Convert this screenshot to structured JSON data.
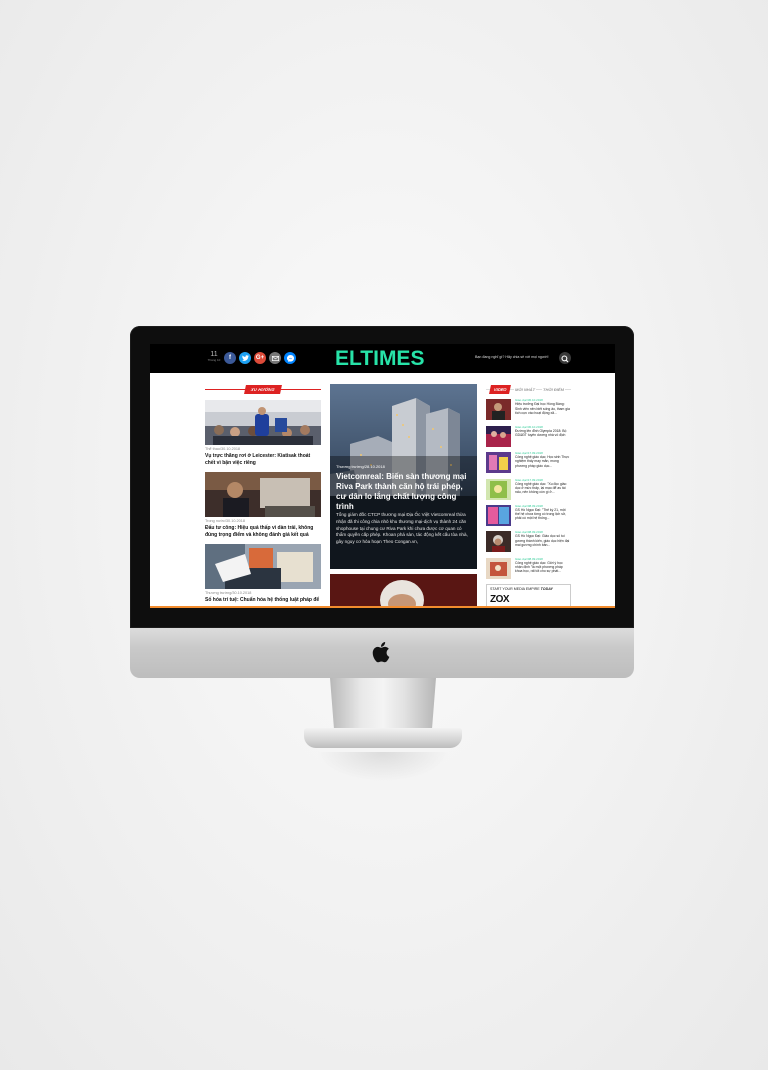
{
  "header": {
    "date_day": "11",
    "date_month": "Tháng 10",
    "logo": "ELTIMES",
    "search_placeholder": "Bạn đang nghĩ gì? Hãy chia sẻ với mọi người!",
    "social_icons": [
      "facebook-icon",
      "twitter-icon",
      "google-plus-icon",
      "mail-icon",
      "messenger-icon"
    ]
  },
  "left": {
    "section_label": "XU HƯỚNG",
    "items": [
      {
        "meta": "Thể thao/30.10.2018",
        "title": "Vụ trực thăng rơi ở Leicester: Kiatisak thoát chết vì bận việc riêng"
      },
      {
        "meta": "Trong nước/30.10.2018",
        "title": "Đấu tư công: Hiệu quả thấp vì dàn trải, không đúng trọng điểm và không đánh giá kết quả"
      },
      {
        "meta": "Thương trường/30.10.2018",
        "title": "Số hóa trí tuệ: Chuẩn hóa hệ thống luật pháp để"
      }
    ]
  },
  "center": {
    "hero_date": "Thương trường/28.10.2018",
    "hero_title": "Vietcomreal: Biến sàn thương mại Riva Park thành căn hộ trái phép, cư dân lo lắng chất lượng công trình",
    "hero_desc": "Tổng giám đốc CTCP thương mại Địa Ốc Việt Vietcomreal thừa nhận đã thi công chia nhỏ khu thương mại-dịch vụ thành 24 căn shophouse tại chung cư Riva Park khi chưa được cơ quan có thẩm quyền cấp phép. Khoan phá sàn, tác động kết cấu tòa nhà, gây nguy cơ hỏa hoạn Theo Congan.vn,"
  },
  "right": {
    "tab_video": "VIDEO",
    "tab_new": "MỚI NHẤT",
    "tab_hot": "THỜI ĐIỂM",
    "items": [
      {
        "meta": "Giáo dục/30.10.2018",
        "title": "Hiệu trưởng Đại học Hồng Bàng: Sinh viên nên biết sống ảo, tham gia tích cực vào hoạt động xã..."
      },
      {
        "meta": "Giáo dục/30.10.2018",
        "title": "Đường lên đỉnh Olympia 2018: Bộ GD&ĐT tuyên dương nhà vô địch"
      },
      {
        "meta": "Giáo dục/17.09.2018",
        "title": "Công nghệ giáo dục: Học sinh Thực nghiệm thấy may mắn, mong phương pháp giáo dục..."
      },
      {
        "meta": "Giáo dục/17.09.2018",
        "title": "Công nghệ giáo dục: \"Xu đọc giáo dục ở mức thấp, lại mạo để as tái nấu, nên không còn gì ở..."
      },
      {
        "meta": "Giáo dục/08.09.2018",
        "title": "GS Hồ Ngọc Đại: \"Thế kỷ 21, một thế hệ chưa từng có trong lịch sử, phải có một hệ thống..."
      },
      {
        "meta": "Giáo dục/08.09.2018",
        "title": "GS Hồ Ngọc Đại: Giáo dục số tuí gương thành kiến, giáo dục hiện đại mai gương chính bản..."
      },
      {
        "meta": "Giáo dục/08.09.2018",
        "title": "Công nghệ giáo dục: Giới ý học nhận định \"là một phương pháp khoa học, rất tốt cho sự phát..."
      }
    ],
    "promo_text": "START YOUR MEDIA EMPIRE",
    "promo_emph": "TODAY",
    "promo_logo": "ZOX"
  }
}
